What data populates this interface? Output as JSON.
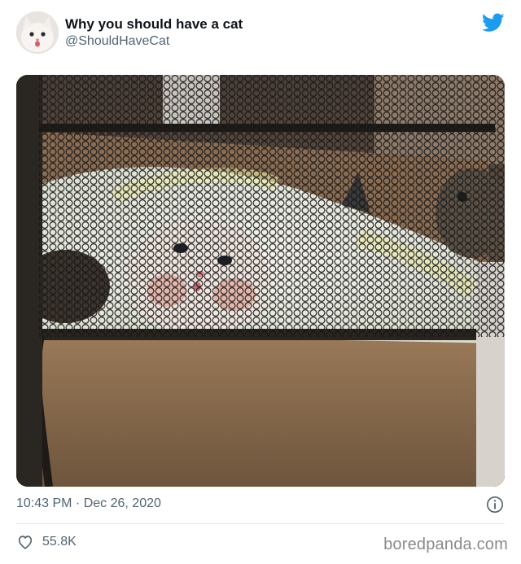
{
  "tweet": {
    "author": {
      "display_name": "Why you should have a cat",
      "handle": "@ShouldHaveCat",
      "avatar_icon": "cat-face-avatar"
    },
    "brand_icon": "twitter-bird-icon",
    "timestamp": "10:43 PM · Dec 26, 2020",
    "info_icon": "info-icon",
    "likes": {
      "icon": "heart-icon",
      "count": "55.8K"
    }
  },
  "watermark": "boredpanda.com",
  "colors": {
    "twitter_blue": "#1d9bf0",
    "secondary_text": "#536471",
    "primary_text": "#0f1419",
    "divider": "#e1e8ed"
  }
}
